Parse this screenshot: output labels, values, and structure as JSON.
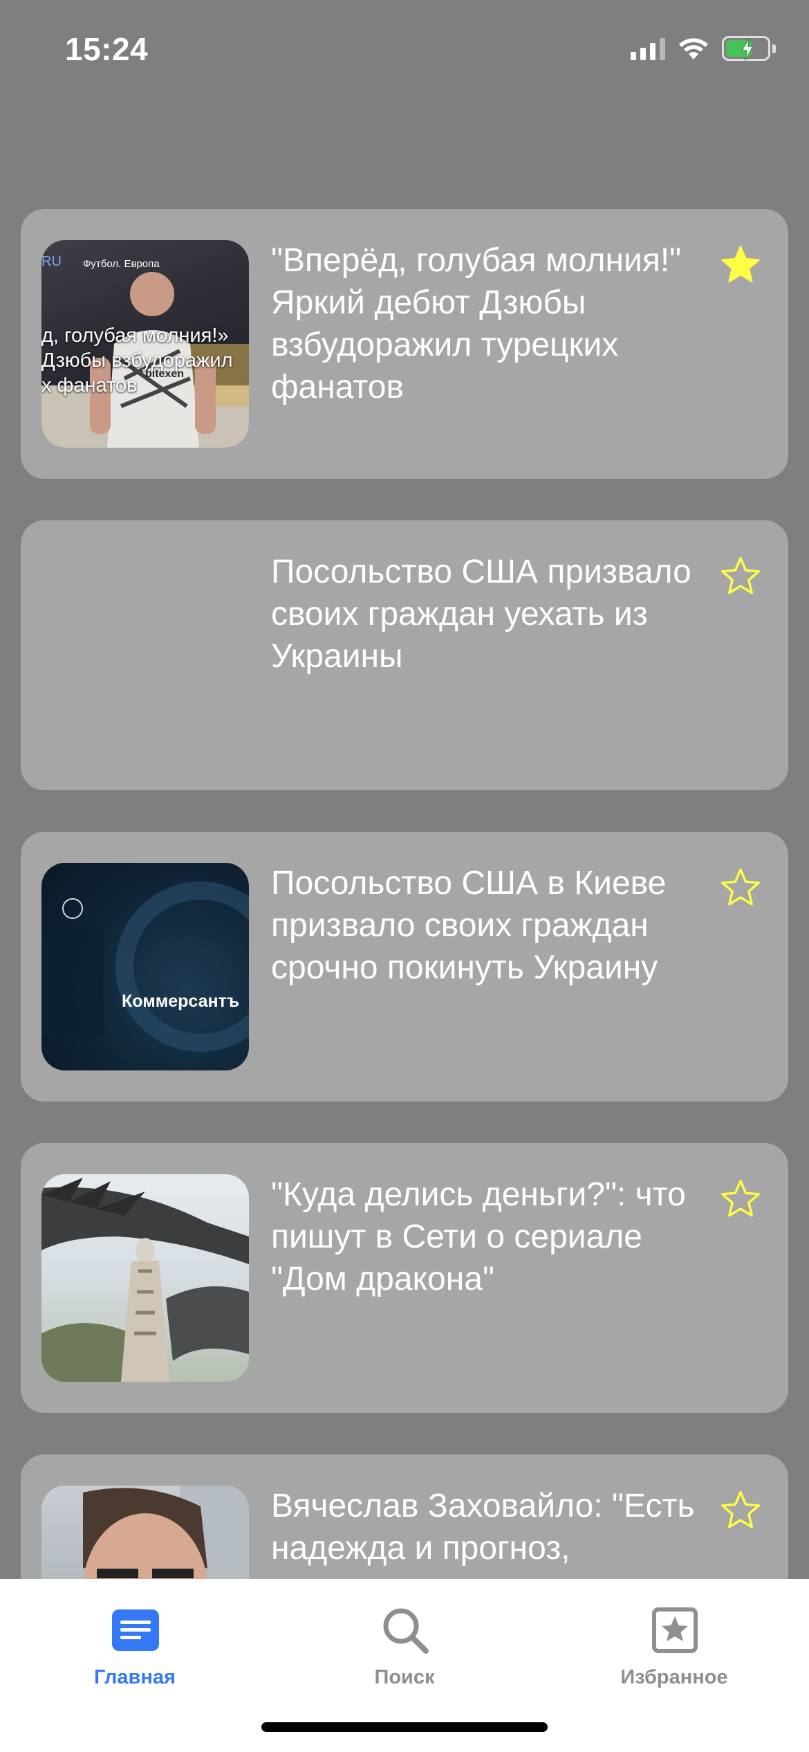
{
  "status_bar": {
    "time": "15:24"
  },
  "colors": {
    "background": "#7f7f7f",
    "card": "#a6a6a6",
    "star_active": "#ffff44",
    "star_inactive_outline": "#ffff44",
    "tab_active": "#3478f6",
    "tab_inactive": "#8e8e93"
  },
  "feed": {
    "items": [
      {
        "title": "\"Вперёд, голубая молния!\" Яркий дебют Дзюбы взбудоражил турецких фанатов",
        "favorite": true,
        "thumb": {
          "kind": "photo-sport",
          "tag": "Футбол. Европа",
          "prefix": "RU",
          "caption_lines": [
            "д, голубая молния!»",
            "Дзюбы взбудоражил",
            "х фанатов"
          ],
          "jersey_text": "bitexen"
        }
      },
      {
        "title": "Посольство США призвало своих граждан уехать из Украины",
        "favorite": false,
        "thumb": null
      },
      {
        "title": "Посольство США в Киеве призвало своих граждан срочно покинуть Украину",
        "favorite": false,
        "thumb": {
          "kind": "logo-dark",
          "brand": "Коммерсантъ"
        }
      },
      {
        "title": "\"Куда делись деньги?\": что пишут в Сети о сериале \"Дом дракона\"",
        "favorite": false,
        "thumb": {
          "kind": "photo-dragon"
        }
      },
      {
        "title": "Вячеслав Заховайло: \"Есть надежда и прогноз,",
        "favorite": false,
        "thumb": {
          "kind": "photo-portrait"
        }
      }
    ]
  },
  "tab_bar": {
    "tabs": [
      {
        "label": "Главная",
        "icon": "newspaper-icon",
        "active": true
      },
      {
        "label": "Поиск",
        "icon": "search-icon",
        "active": false
      },
      {
        "label": "Избранное",
        "icon": "star-square-icon",
        "active": false
      }
    ]
  }
}
